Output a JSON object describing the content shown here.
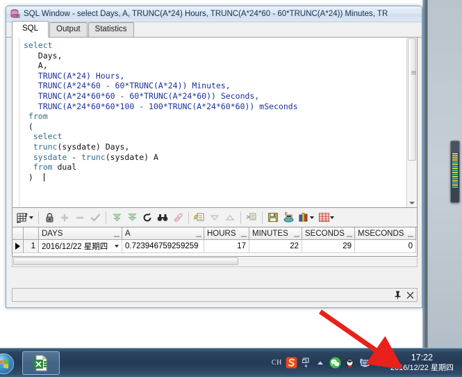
{
  "window": {
    "title": "SQL Window - select Days, A, TRUNC(A*24) Hours, TRUNC(A*24*60 - 60*TRUNC(A*24)) Minutes, TR",
    "icon": "sql-window-icon"
  },
  "tabs": [
    {
      "label": "SQL",
      "active": true
    },
    {
      "label": "Output",
      "active": false
    },
    {
      "label": "Statistics",
      "active": false
    }
  ],
  "editor": {
    "lines": [
      [
        {
          "t": "select",
          "c": "kw"
        }
      ],
      [
        {
          "t": "   Days,",
          "c": "plain"
        }
      ],
      [
        {
          "t": "   A,",
          "c": "plain"
        }
      ],
      [
        {
          "t": "   ",
          "c": "plain"
        },
        {
          "t": "TRUNC",
          "c": "fn"
        },
        {
          "t": "(A*24) Hours,",
          "c": "fn"
        }
      ],
      [
        {
          "t": "   ",
          "c": "plain"
        },
        {
          "t": "TRUNC(A*24*60 - 60*TRUNC(A*24)) Minutes,",
          "c": "fn"
        }
      ],
      [
        {
          "t": "   ",
          "c": "plain"
        },
        {
          "t": "TRUNC(A*24*60*60 - 60*TRUNC(A*24*60)) Seconds,",
          "c": "fn"
        }
      ],
      [
        {
          "t": "   ",
          "c": "plain"
        },
        {
          "t": "TRUNC(A*24*60*60*100 - 100*TRUNC(A*24*60*60)) mSeconds",
          "c": "fn"
        }
      ],
      [
        {
          "t": " from",
          "c": "kw"
        }
      ],
      [
        {
          "t": " (",
          "c": "plain"
        }
      ],
      [
        {
          "t": "  ",
          "c": "plain"
        },
        {
          "t": "select",
          "c": "kw"
        }
      ],
      [
        {
          "t": "  ",
          "c": "plain"
        },
        {
          "t": "trunc",
          "c": "kw"
        },
        {
          "t": "(sysdate) Days,",
          "c": "plain"
        }
      ],
      [
        {
          "t": "  ",
          "c": "plain"
        },
        {
          "t": "sysdate",
          "c": "kw"
        },
        {
          "t": " - ",
          "c": "plain"
        },
        {
          "t": "trunc",
          "c": "kw"
        },
        {
          "t": "(sysdate) A",
          "c": "plain"
        }
      ],
      [
        {
          "t": "  ",
          "c": "plain"
        },
        {
          "t": "from",
          "c": "kw"
        },
        {
          "t": " dual",
          "c": "plain"
        }
      ],
      [
        {
          "t": " )",
          "c": "plain"
        }
      ]
    ]
  },
  "toolbar": {
    "items": [
      {
        "name": "grid-layout-button",
        "label": ""
      },
      {
        "name": "grid-layout-dropdown",
        "label": ""
      },
      {
        "name": "lock-button",
        "label": ""
      },
      {
        "name": "insert-record-button",
        "label": ""
      },
      {
        "name": "delete-record-button",
        "label": ""
      },
      {
        "name": "post-changes-button",
        "label": ""
      },
      {
        "name": "fetch-next-page-button",
        "label": ""
      },
      {
        "name": "fetch-last-page-button",
        "label": ""
      },
      {
        "name": "refresh-button",
        "label": ""
      },
      {
        "name": "find-button",
        "label": ""
      },
      {
        "name": "clear-filter-button",
        "label": ""
      },
      {
        "name": "copy-records-button",
        "label": ""
      },
      {
        "name": "sort-descending-button",
        "label": ""
      },
      {
        "name": "sort-ascending-button",
        "label": ""
      },
      {
        "name": "query-builder-button",
        "label": ""
      },
      {
        "name": "save-button",
        "label": ""
      },
      {
        "name": "export-button",
        "label": ""
      },
      {
        "name": "chart-button",
        "label": ""
      },
      {
        "name": "chart-dropdown",
        "label": ""
      },
      {
        "name": "grid-view-button",
        "label": ""
      },
      {
        "name": "grid-view-dropdown",
        "label": ""
      }
    ]
  },
  "results": {
    "columns": [
      {
        "label": "DAYS",
        "width": 120
      },
      {
        "label": "A",
        "width": 118
      },
      {
        "label": "HOURS",
        "width": 65
      },
      {
        "label": "MINUTES",
        "width": 76
      },
      {
        "label": "SECONDS",
        "width": 76
      },
      {
        "label": "MSECONDS",
        "width": 88
      }
    ],
    "rows": [
      {
        "number": "1",
        "cells": [
          "2016/12/22 星期四",
          "0.723946759259259",
          "17",
          "22",
          "29",
          "0"
        ]
      }
    ]
  },
  "taskbar": {
    "start_label": "start-orb",
    "buttons": [
      {
        "name": "taskbar-button-browser",
        "label": ""
      },
      {
        "name": "taskbar-button-excel",
        "label": ""
      }
    ],
    "tray": {
      "language_indicator": "CH",
      "icons": [
        "sogou-ime-icon",
        "ime-toolbar-icon",
        "show-hidden-icons-icon",
        "wechat-icon",
        "qq-icon",
        "network-icon",
        "volume-icon"
      ]
    },
    "clock": {
      "time": "17:22",
      "date": "2016/12/22 星期四"
    }
  },
  "bottom_panel": {
    "pin_label": "📌",
    "close_label": "✕"
  },
  "colors": {
    "keyword": "#2f6d8f",
    "function": "#1b2f9c",
    "titlebar_text": "#15314d",
    "arrow": "#e8211a"
  }
}
